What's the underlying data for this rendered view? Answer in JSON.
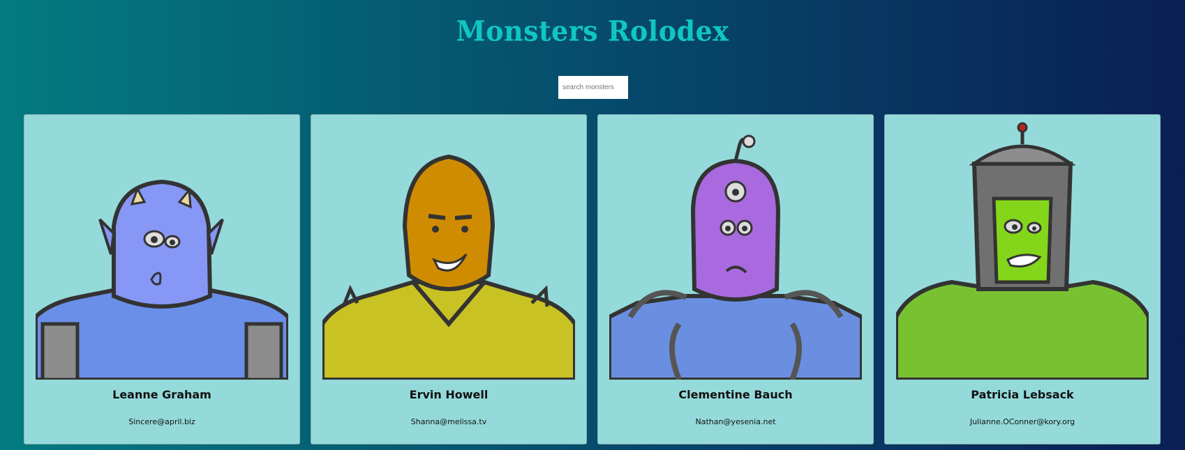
{
  "app": {
    "title": "Monsters Rolodex"
  },
  "search": {
    "placeholder": "search monsters",
    "value": ""
  },
  "monsters": [
    {
      "name": "Leanne Graham",
      "email": "Sincere@april.biz"
    },
    {
      "name": "Ervin Howell",
      "email": "Shanna@melissa.tv"
    },
    {
      "name": "Clementine Bauch",
      "email": "Nathan@yesenia.net"
    },
    {
      "name": "Patricia Lebsack",
      "email": "Julianne.OConner@kory.org"
    }
  ],
  "colors": {
    "title": "#10c6c2",
    "card_bg": "#95dada",
    "bg_left": "#037b80",
    "bg_right": "#0a1f55"
  }
}
